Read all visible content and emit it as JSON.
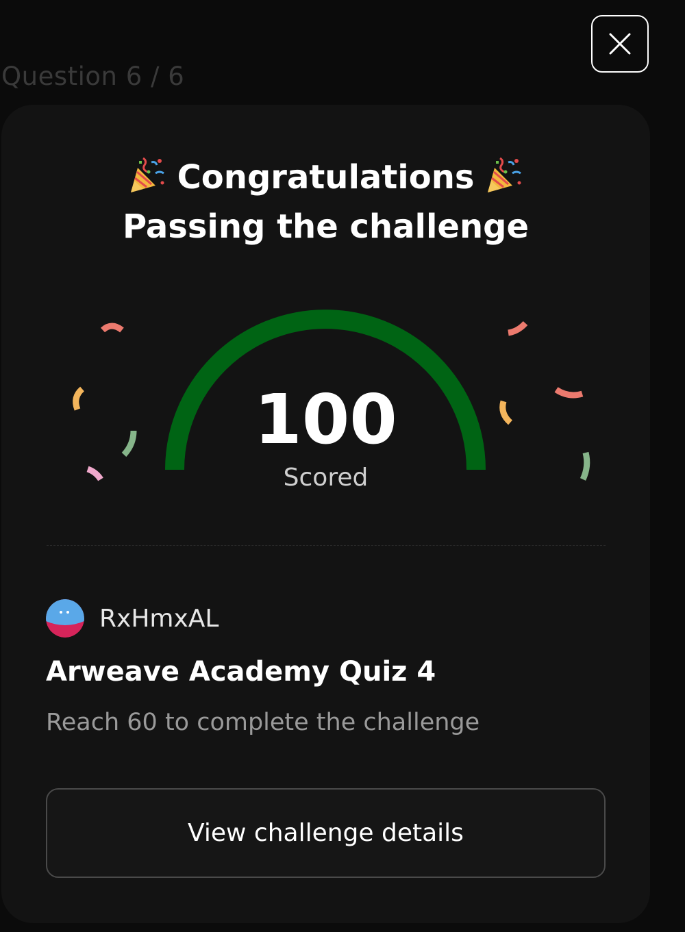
{
  "header": {
    "question_counter": "Question 6 / 6",
    "close_icon": "close-icon"
  },
  "result": {
    "title": "Congratulations",
    "subtitle": "Passing the challenge",
    "celebration_icon": "party-popper-icon",
    "score": "100",
    "score_label": "Scored",
    "gauge_fraction": 1.0,
    "gauge_color": "#006414"
  },
  "challenge": {
    "creator_name": "RxHmxAL",
    "title": "Arweave Academy Quiz 4",
    "requirement": "Reach 60 to complete the challenge",
    "details_button": "View challenge details"
  },
  "colors": {
    "background": "#0b0b0b",
    "card": "#131313",
    "confetti_red": "#ec7a6e",
    "confetti_yellow": "#f3b55c",
    "confetti_green": "#86b58a",
    "confetti_pink": "#f0a9cc"
  }
}
